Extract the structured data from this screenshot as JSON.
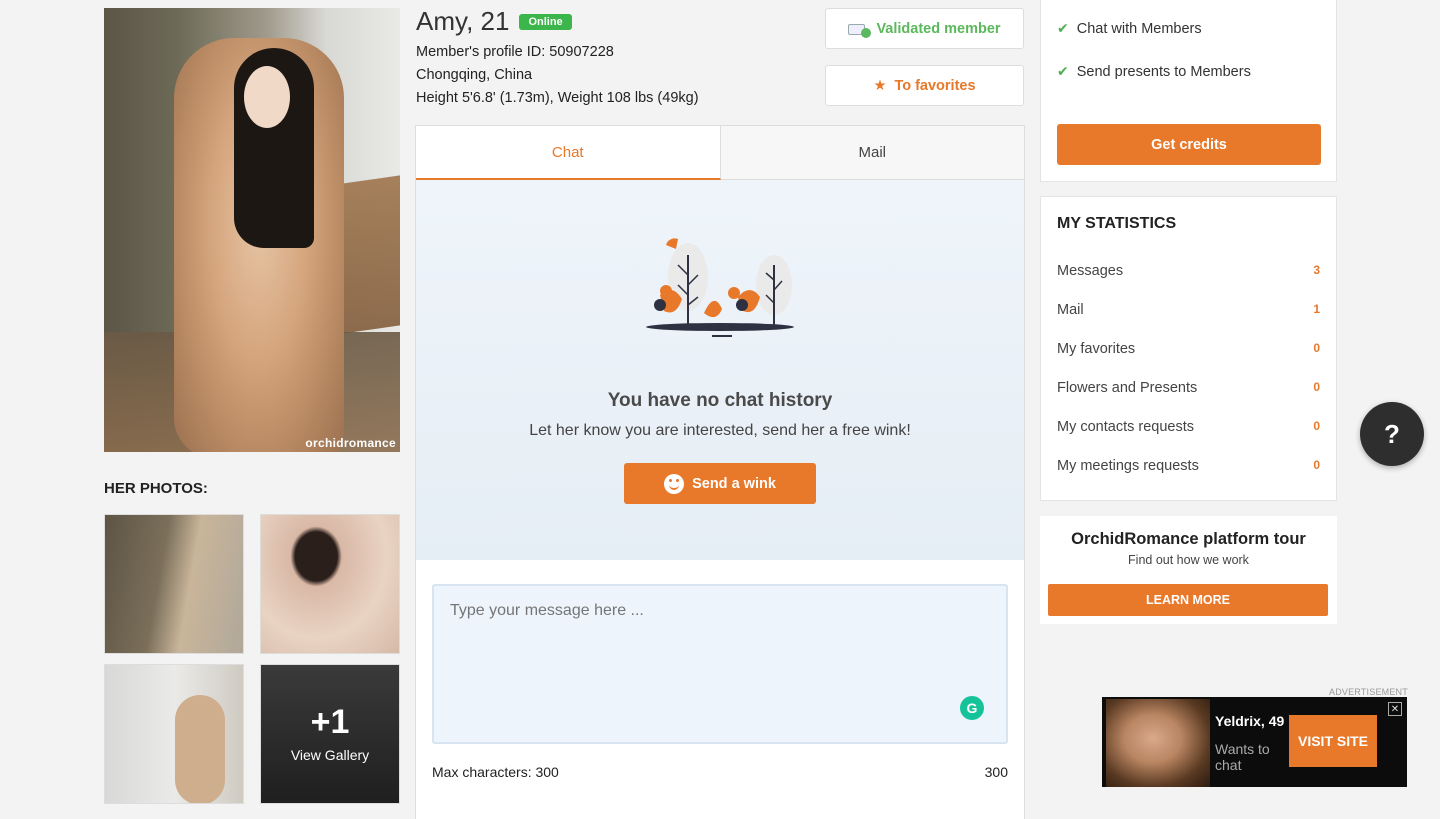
{
  "profile": {
    "name_age": "Amy, 21",
    "status_badge": "Online",
    "profile_id": "Member's profile ID: 50907228",
    "location": "Chongqing, China",
    "physical": "Height 5'6.8' (1.73m), Weight 108 lbs (49kg)",
    "watermark": "orchidromance"
  },
  "photos": {
    "title": "HER PHOTOS:",
    "more_count": "+1",
    "view_gallery": "View Gallery"
  },
  "actions": {
    "validated": "Validated member",
    "favorites": "To favorites"
  },
  "chat": {
    "tabs": [
      "Chat",
      "Mail"
    ],
    "empty_title": "You have no chat history",
    "empty_sub": "Let her know you are interested, send her a free wink!",
    "wink_button": "Send a wink",
    "message_placeholder": "Type your message here ...",
    "max_chars_label": "Max characters: 300",
    "chars_remaining": "300"
  },
  "credits": {
    "features": [
      "Chat with Members",
      "Send presents to Members"
    ],
    "button": "Get credits"
  },
  "statistics": {
    "title": "MY STATISTICS",
    "rows": [
      {
        "label": "Messages",
        "value": "3"
      },
      {
        "label": "Mail",
        "value": "1"
      },
      {
        "label": "My favorites",
        "value": "0"
      },
      {
        "label": "Flowers and Presents",
        "value": "0"
      },
      {
        "label": "My contacts requests",
        "value": "0"
      },
      {
        "label": "My meetings requests",
        "value": "0"
      }
    ]
  },
  "tour": {
    "title": "OrchidRomance platform tour",
    "subtitle": "Find out how we work",
    "button": "LEARN MORE"
  },
  "help": {
    "label": "?"
  },
  "ad": {
    "label": "ADVERTISEMENT",
    "name": "Yeldrix, 49",
    "text": "Wants to chat",
    "button": "VISIT SITE",
    "close": "✕"
  },
  "colors": {
    "accent": "#e8782a",
    "online": "#3cb54a",
    "validated": "#5cb85c"
  }
}
